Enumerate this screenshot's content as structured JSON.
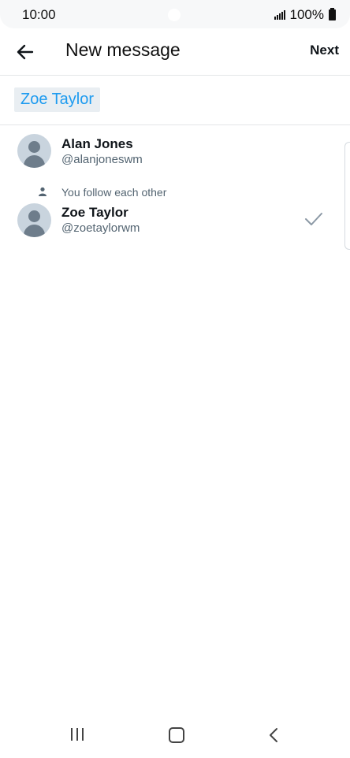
{
  "status_bar": {
    "time": "10:00",
    "battery": "100%"
  },
  "header": {
    "title": "New message",
    "next_label": "Next"
  },
  "recipients": {
    "chip_label": "Zoe Taylor"
  },
  "results": [
    {
      "name": "Alan Jones",
      "handle": "@alanjoneswm",
      "note": "",
      "selected": false
    },
    {
      "name": "Zoe Taylor",
      "handle": "@zoetaylorwm",
      "note": "You follow each other",
      "selected": true
    }
  ],
  "colors": {
    "accent": "#1d9bf0",
    "chip_bg": "#e9eef2",
    "avatar_bg": "#c9d4de",
    "secondary_text": "#536471"
  },
  "icons": [
    "back-arrow-icon",
    "person-icon",
    "check-icon",
    "signal-icon",
    "battery-icon"
  ]
}
